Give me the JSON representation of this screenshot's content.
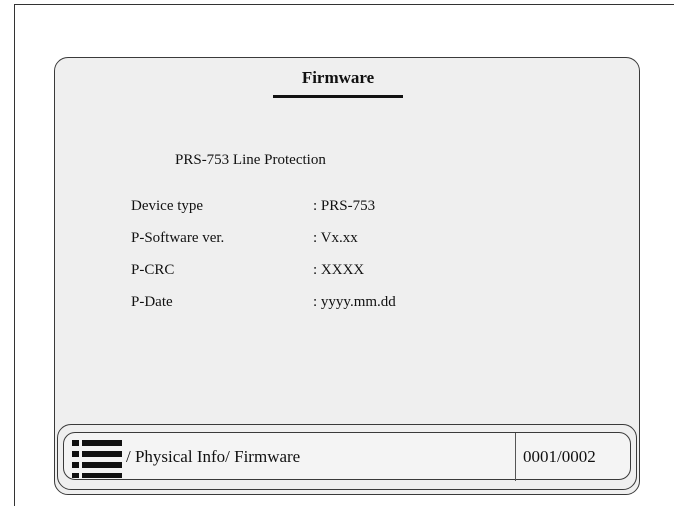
{
  "screen": {
    "title": "Firmware",
    "device_name": "PRS-753 Line Protection",
    "info": [
      {
        "label": "Device type",
        "value": ": PRS-753"
      },
      {
        "label": "P-Software ver.",
        "value": ": Vx.xx"
      },
      {
        "label": "P-CRC",
        "value": ": XXXX"
      },
      {
        "label": "P-Date",
        "value": ": yyyy.mm.dd"
      }
    ]
  },
  "status_bar": {
    "menu_icon": "menu-list-icon",
    "path": "/ Physical Info/ Firmware",
    "page_counter": "0001/0002"
  }
}
